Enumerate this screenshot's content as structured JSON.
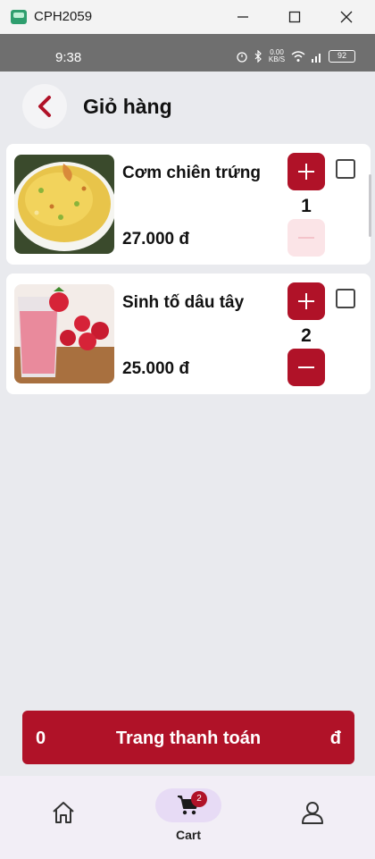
{
  "window": {
    "title": "CPH2059"
  },
  "status_bar": {
    "time": "9:38",
    "network_speed": "0.00\nKB/S",
    "battery": "92"
  },
  "header": {
    "title": "Giỏ hàng"
  },
  "cart_items": [
    {
      "name": "Cơm chiên trứng",
      "price": "27.000 đ",
      "quantity": "1",
      "image_icon": "fried-rice-photo",
      "minus_enabled": false
    },
    {
      "name": "Sinh tố dâu tây",
      "price": "25.000 đ",
      "quantity": "2",
      "image_icon": "strawberry-smoothie-photo",
      "minus_enabled": true
    }
  ],
  "checkout": {
    "total": "0",
    "label": "Trang thanh toán",
    "currency": "đ"
  },
  "bottom_nav": {
    "cart_label": "Cart",
    "cart_badge": "2"
  },
  "colors": {
    "accent": "#b01228",
    "background": "#e9eaee",
    "card": "#ffffff"
  }
}
